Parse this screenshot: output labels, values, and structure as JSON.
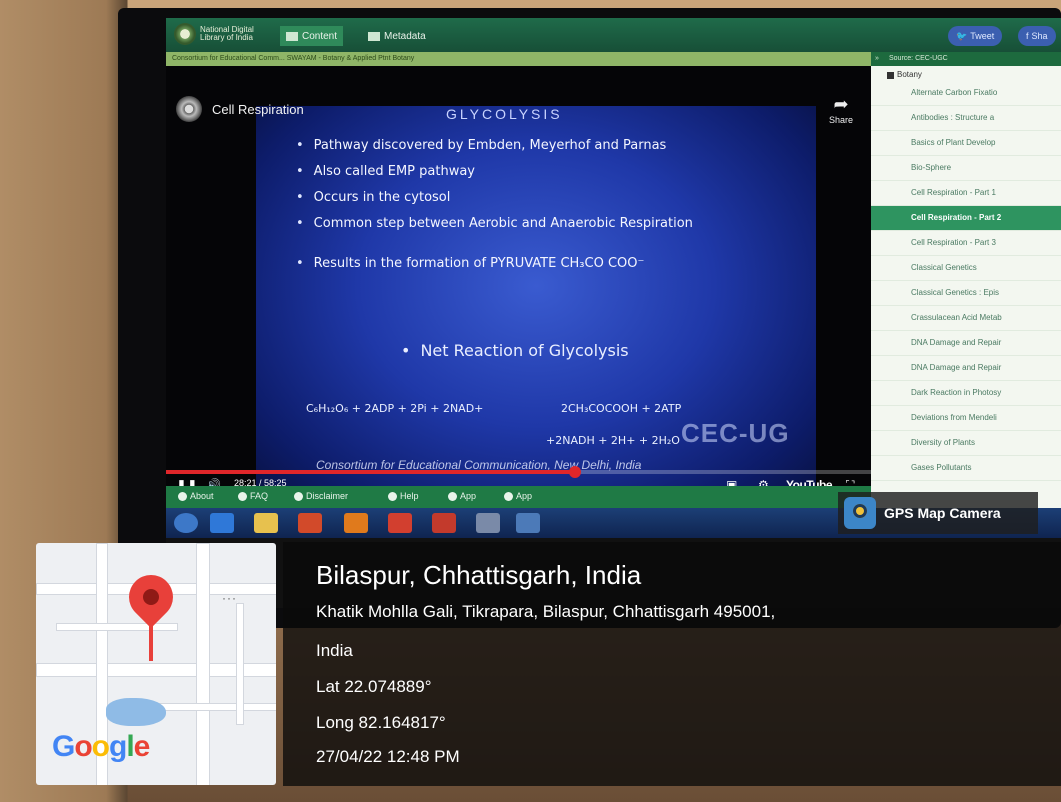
{
  "site": {
    "logo_text": "National Digital Library of India",
    "tabs": [
      {
        "label": "Content"
      },
      {
        "label": "Metadata"
      }
    ],
    "share_buttons": [
      {
        "label": "Tweet"
      },
      {
        "label": "Sha"
      }
    ],
    "breadcrumb": "Consortium for Educational Comm...   SWAYAM - Botany & Applied Ptnt   Botany"
  },
  "player": {
    "title": "Cell Respiration",
    "share_label": "Share",
    "time": "28:21 / 58:25",
    "progress": 0.58,
    "brand": "YouTube"
  },
  "slide": {
    "heading": "GLYCOLYSIS",
    "bullets": [
      "Pathway discovered by Embden, Meyerhof and Parnas",
      "Also called EMP pathway",
      "Occurs in the cytosol",
      "Common step between Aerobic and Anaerobic Respiration",
      "Results in the formation of PYRUVATE CH₃CO COO⁻"
    ],
    "subheading": "Net Reaction of Glycolysis",
    "equation_left": "C₆H₁₂O₆ + 2ADP + 2Pi + 2NAD+",
    "equation_right_1": "2CH₃COCOOH + 2ATP",
    "equation_right_2": "+2NADH + 2H+ + 2H₂O",
    "watermark": "CEC-UG",
    "caption": "Consortium for Educational Communication, New Delhi, India"
  },
  "sidebar": {
    "source": "Source: CEC-UGC",
    "root": "Botany",
    "items": [
      {
        "label": "Alternate Carbon Fixatio",
        "active": false
      },
      {
        "label": "Antibodies : Structure a",
        "active": false
      },
      {
        "label": "Basics of Plant Develop",
        "active": false
      },
      {
        "label": "Bio-Sphere",
        "active": false
      },
      {
        "label": "Cell Respiration - Part 1",
        "active": false
      },
      {
        "label": "Cell Respiration - Part 2",
        "active": true
      },
      {
        "label": "Cell Respiration - Part 3",
        "active": false
      },
      {
        "label": "Classical Genetics",
        "active": false
      },
      {
        "label": "Classical Genetics : Epis",
        "active": false
      },
      {
        "label": "Crassulacean Acid Metab",
        "active": false
      },
      {
        "label": "DNA Damage and Repair",
        "active": false
      },
      {
        "label": "DNA Damage and Repair",
        "active": false
      },
      {
        "label": "Dark Reaction in Photosy",
        "active": false
      },
      {
        "label": "Deviations from Mendeli",
        "active": false
      },
      {
        "label": "Diversity of Plants",
        "active": false
      },
      {
        "label": "Gases Pollutants",
        "active": false
      }
    ]
  },
  "footer_links": [
    "About",
    "FAQ",
    "Disclaimer",
    "Help",
    "App",
    "App"
  ],
  "gps": {
    "app_name": "GPS Map Camera",
    "city": "Bilaspur, Chhattisgarh, India",
    "address_line1": "Khatik Mohlla Gali, Tikrapara, Bilaspur, Chhattisgarh 495001,",
    "address_line2": "India",
    "lat": "Lat 22.074889°",
    "long": "Long 82.164817°",
    "timestamp": "27/04/22 12:48 PM",
    "map_brand": "Google",
    "pin_color": "#e8403a"
  }
}
